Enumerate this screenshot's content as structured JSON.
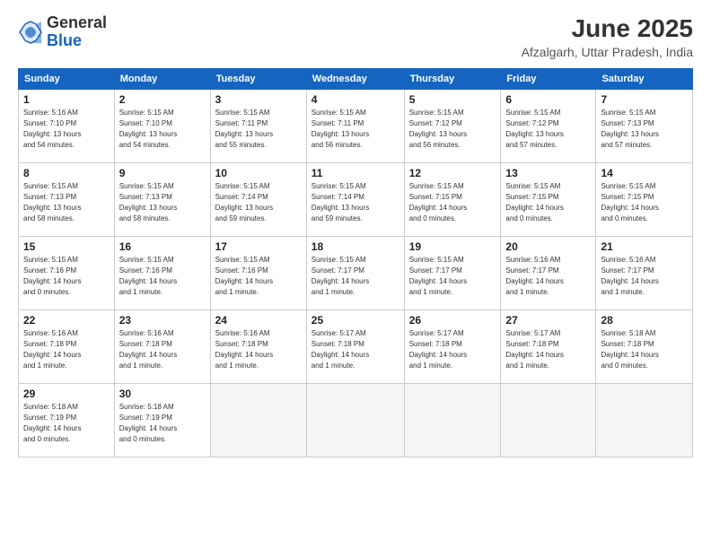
{
  "header": {
    "logo_line1": "General",
    "logo_line2": "Blue",
    "month": "June 2025",
    "location": "Afzalgarh, Uttar Pradesh, India"
  },
  "columns": [
    "Sunday",
    "Monday",
    "Tuesday",
    "Wednesday",
    "Thursday",
    "Friday",
    "Saturday"
  ],
  "weeks": [
    [
      {
        "day": "1",
        "info": "Sunrise: 5:16 AM\nSunset: 7:10 PM\nDaylight: 13 hours\nand 54 minutes."
      },
      {
        "day": "2",
        "info": "Sunrise: 5:15 AM\nSunset: 7:10 PM\nDaylight: 13 hours\nand 54 minutes."
      },
      {
        "day": "3",
        "info": "Sunrise: 5:15 AM\nSunset: 7:11 PM\nDaylight: 13 hours\nand 55 minutes."
      },
      {
        "day": "4",
        "info": "Sunrise: 5:15 AM\nSunset: 7:11 PM\nDaylight: 13 hours\nand 56 minutes."
      },
      {
        "day": "5",
        "info": "Sunrise: 5:15 AM\nSunset: 7:12 PM\nDaylight: 13 hours\nand 56 minutes."
      },
      {
        "day": "6",
        "info": "Sunrise: 5:15 AM\nSunset: 7:12 PM\nDaylight: 13 hours\nand 57 minutes."
      },
      {
        "day": "7",
        "info": "Sunrise: 5:15 AM\nSunset: 7:13 PM\nDaylight: 13 hours\nand 57 minutes."
      }
    ],
    [
      {
        "day": "8",
        "info": "Sunrise: 5:15 AM\nSunset: 7:13 PM\nDaylight: 13 hours\nand 58 minutes."
      },
      {
        "day": "9",
        "info": "Sunrise: 5:15 AM\nSunset: 7:13 PM\nDaylight: 13 hours\nand 58 minutes."
      },
      {
        "day": "10",
        "info": "Sunrise: 5:15 AM\nSunset: 7:14 PM\nDaylight: 13 hours\nand 59 minutes."
      },
      {
        "day": "11",
        "info": "Sunrise: 5:15 AM\nSunset: 7:14 PM\nDaylight: 13 hours\nand 59 minutes."
      },
      {
        "day": "12",
        "info": "Sunrise: 5:15 AM\nSunset: 7:15 PM\nDaylight: 14 hours\nand 0 minutes."
      },
      {
        "day": "13",
        "info": "Sunrise: 5:15 AM\nSunset: 7:15 PM\nDaylight: 14 hours\nand 0 minutes."
      },
      {
        "day": "14",
        "info": "Sunrise: 5:15 AM\nSunset: 7:15 PM\nDaylight: 14 hours\nand 0 minutes."
      }
    ],
    [
      {
        "day": "15",
        "info": "Sunrise: 5:15 AM\nSunset: 7:16 PM\nDaylight: 14 hours\nand 0 minutes."
      },
      {
        "day": "16",
        "info": "Sunrise: 5:15 AM\nSunset: 7:16 PM\nDaylight: 14 hours\nand 1 minute."
      },
      {
        "day": "17",
        "info": "Sunrise: 5:15 AM\nSunset: 7:16 PM\nDaylight: 14 hours\nand 1 minute."
      },
      {
        "day": "18",
        "info": "Sunrise: 5:15 AM\nSunset: 7:17 PM\nDaylight: 14 hours\nand 1 minute."
      },
      {
        "day": "19",
        "info": "Sunrise: 5:15 AM\nSunset: 7:17 PM\nDaylight: 14 hours\nand 1 minute."
      },
      {
        "day": "20",
        "info": "Sunrise: 5:16 AM\nSunset: 7:17 PM\nDaylight: 14 hours\nand 1 minute."
      },
      {
        "day": "21",
        "info": "Sunrise: 5:16 AM\nSunset: 7:17 PM\nDaylight: 14 hours\nand 1 minute."
      }
    ],
    [
      {
        "day": "22",
        "info": "Sunrise: 5:16 AM\nSunset: 7:18 PM\nDaylight: 14 hours\nand 1 minute."
      },
      {
        "day": "23",
        "info": "Sunrise: 5:16 AM\nSunset: 7:18 PM\nDaylight: 14 hours\nand 1 minute."
      },
      {
        "day": "24",
        "info": "Sunrise: 5:16 AM\nSunset: 7:18 PM\nDaylight: 14 hours\nand 1 minute."
      },
      {
        "day": "25",
        "info": "Sunrise: 5:17 AM\nSunset: 7:18 PM\nDaylight: 14 hours\nand 1 minute."
      },
      {
        "day": "26",
        "info": "Sunrise: 5:17 AM\nSunset: 7:18 PM\nDaylight: 14 hours\nand 1 minute."
      },
      {
        "day": "27",
        "info": "Sunrise: 5:17 AM\nSunset: 7:18 PM\nDaylight: 14 hours\nand 1 minute."
      },
      {
        "day": "28",
        "info": "Sunrise: 5:18 AM\nSunset: 7:18 PM\nDaylight: 14 hours\nand 0 minutes."
      }
    ],
    [
      {
        "day": "29",
        "info": "Sunrise: 5:18 AM\nSunset: 7:19 PM\nDaylight: 14 hours\nand 0 minutes."
      },
      {
        "day": "30",
        "info": "Sunrise: 5:18 AM\nSunset: 7:19 PM\nDaylight: 14 hours\nand 0 minutes."
      },
      {
        "day": "",
        "info": ""
      },
      {
        "day": "",
        "info": ""
      },
      {
        "day": "",
        "info": ""
      },
      {
        "day": "",
        "info": ""
      },
      {
        "day": "",
        "info": ""
      }
    ]
  ]
}
